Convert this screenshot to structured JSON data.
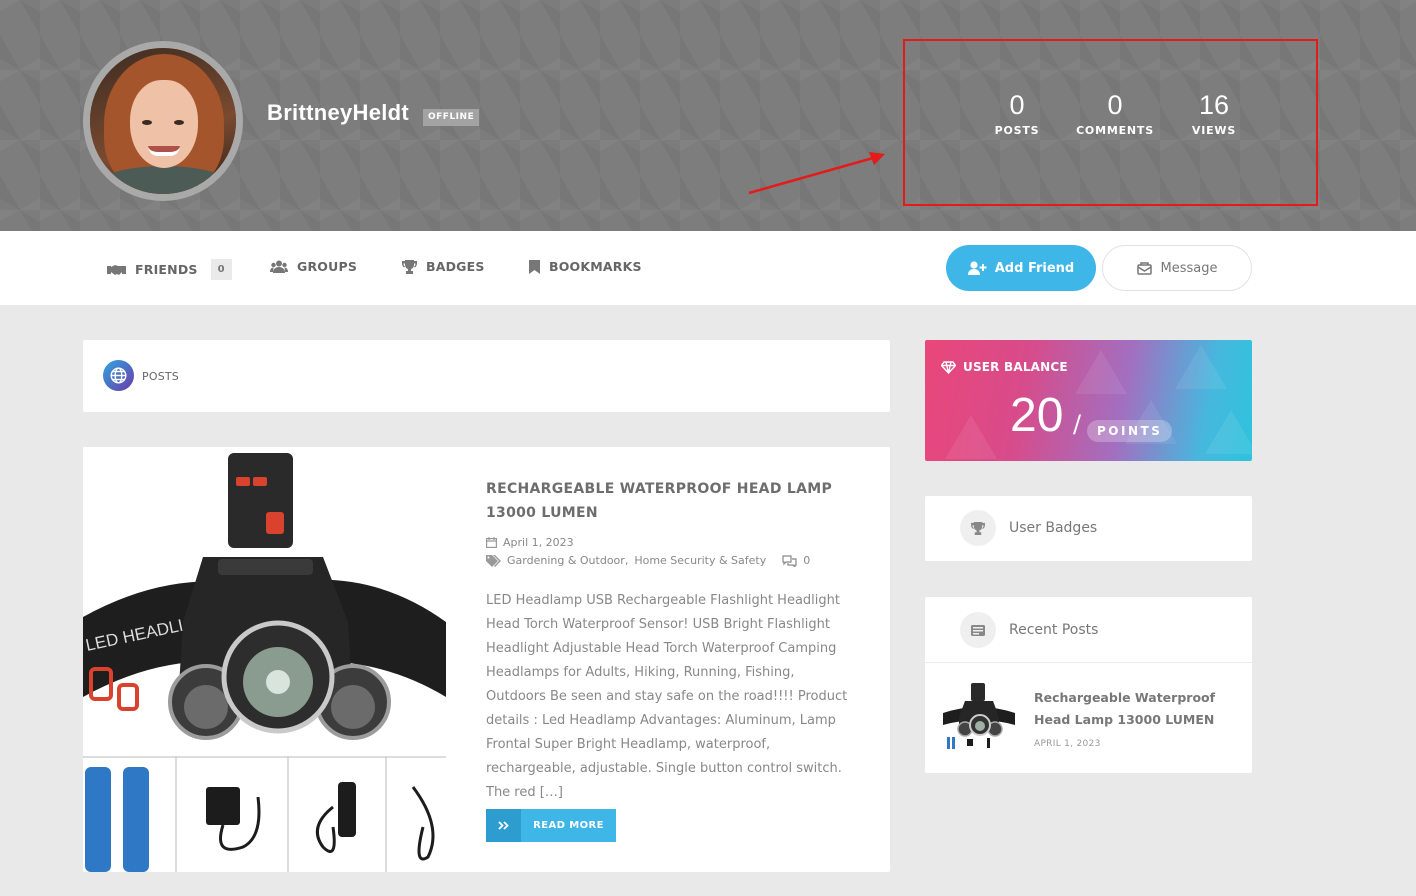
{
  "profile": {
    "username": "BrittneyHeldt",
    "status": "OFFLINE",
    "stats": [
      {
        "value": "0",
        "label": "POSTS"
      },
      {
        "value": "0",
        "label": "COMMENTS"
      },
      {
        "value": "16",
        "label": "VIEWS"
      }
    ]
  },
  "nav": {
    "friends_label": "FRIENDS",
    "friends_count": "0",
    "groups_label": "GROUPS",
    "badges_label": "BADGES",
    "bookmarks_label": "BOOKMARKS",
    "add_friend_label": "Add Friend",
    "message_label": "Message"
  },
  "posts_section": {
    "title": "POSTS"
  },
  "post": {
    "title": "RECHARGEABLE WATERPROOF HEAD LAMP 13000 LUMEN",
    "date": "April 1, 2023",
    "category_1": "Gardening & Outdoor",
    "category_sep": ",",
    "category_2": "Home Security & Safety",
    "comments": "0",
    "excerpt": "LED Headlamp USB Rechargeable Flashlight Headlight Head Torch Waterproof Sensor! USB Bright Flashlight Headlight Adjustable Head Torch Waterproof Camping Headlamps for Adults, Hiking, Running, Fishing, Outdoors Be seen and stay safe on the road!!!! Product details : Led Headlamp Advantages: Aluminum, Lamp Frontal Super Bright Headlamp, waterproof, rechargeable, adjustable. Single button control switch. The red […]",
    "read_more": "READ MORE",
    "image_text": "LED HEADLIGHT"
  },
  "sidebar": {
    "balance": {
      "title": "USER BALANCE",
      "value": "20",
      "separator": "/",
      "unit": "POINTS"
    },
    "badges_widget_title": "User Badges",
    "recent_widget_title": "Recent Posts",
    "recent_posts": [
      {
        "title": "Rechargeable Waterproof Head Lamp 13000 LUMEN",
        "date": "APRIL 1, 2023"
      }
    ]
  },
  "colors": {
    "accent": "#3eb6e7",
    "highlight_box": "#e31b1b",
    "cover": "#7d7d7d"
  },
  "icons": [
    "handshake-icon",
    "users-icon",
    "trophy-icon",
    "bookmark-icon",
    "user-plus-icon",
    "envelope-icon",
    "globe-icon",
    "calendar-icon",
    "tags-icon",
    "comments-icon",
    "double-chevron-icon",
    "diamond-icon",
    "list-icon"
  ]
}
